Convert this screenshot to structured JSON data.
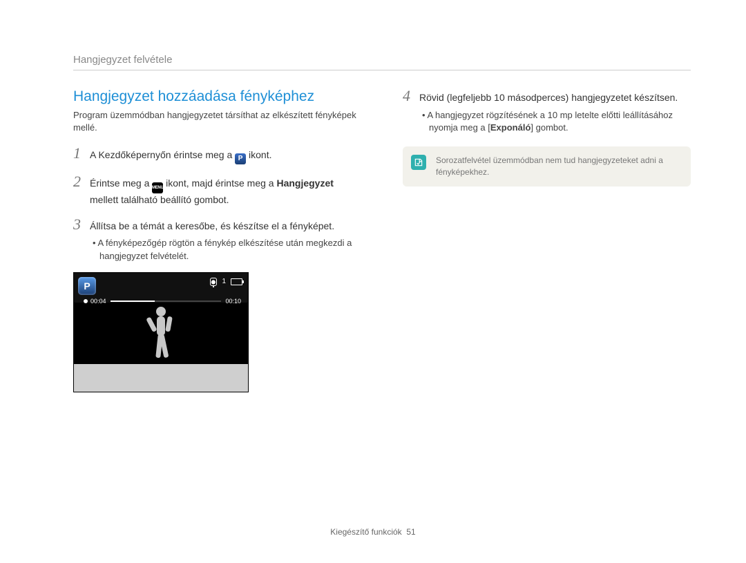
{
  "header": "Hangjegyzet felvétele",
  "section_title": "Hangjegyzet hozzáadása fényképhez",
  "intro": "Program üzemmódban hangjegyzetet társíthat az elkészített fényképek mellé.",
  "steps_left": {
    "s1": {
      "num": "1",
      "pre": "A Kezdőképernyőn érintse meg a ",
      "post": " ikont."
    },
    "s2": {
      "num": "2",
      "pre": "Érintse meg a ",
      "mid": " ikont, majd érintse meg a ",
      "bold": "Hangjegyzet",
      "post": " mellett található beállító gombot."
    },
    "s3": {
      "num": "3",
      "text": "Állítsa be a témát a keresőbe, és készítse el a fényképet.",
      "sub": "A fényképezőgép rögtön a fénykép elkészítése után megkezdi a hangjegyzet felvételét."
    }
  },
  "steps_right": {
    "s4": {
      "num": "4",
      "text": "Rövid (legfeljebb 10 másodperces) hangjegyzetet készítsen.",
      "sub_pre": "A hangjegyzet rögzítésének a 10 mp letelte előtti leállításához nyomja meg a [",
      "sub_bold": "Exponáló",
      "sub_post": "] gombot."
    }
  },
  "note": "Sorozatfelvétel üzemmódban nem tud hangjegyzeteket adni a fényképekhez.",
  "camera": {
    "mode_letter": "P",
    "rec_current": "00:04",
    "rec_total": "00:10",
    "counter": "1"
  },
  "icon_labels": {
    "pmode": "P",
    "menu": "MENU"
  },
  "footer": {
    "section": "Kiegészítő funkciók",
    "page": "51"
  }
}
